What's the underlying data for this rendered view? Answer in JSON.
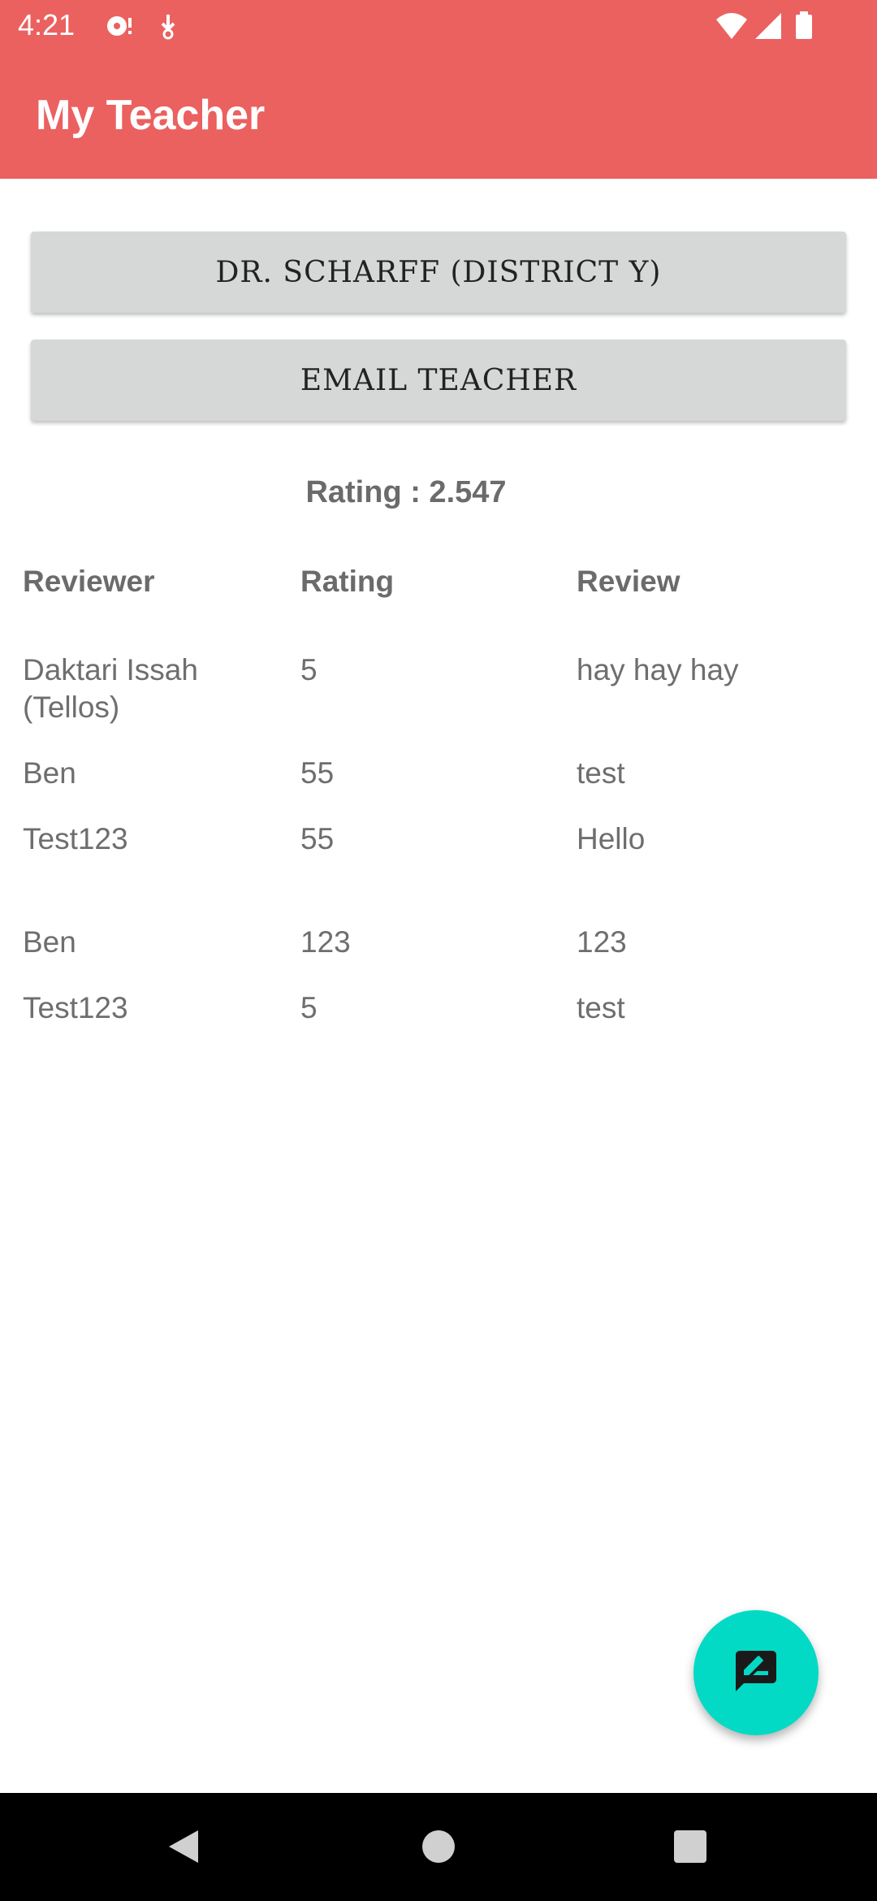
{
  "status_bar": {
    "time": "4:21",
    "left_icons": [
      "sync-icon",
      "download-icon"
    ],
    "right_icons": [
      "wifi-icon",
      "signal-icon",
      "battery-icon"
    ]
  },
  "app_bar": {
    "title": "My Teacher"
  },
  "buttons": {
    "teacher_label": "DR. SCHARFF (DISTRICT Y)",
    "email_label": "EMAIL TEACHER"
  },
  "rating_summary": "Rating : 2.547",
  "table": {
    "headers": [
      "Reviewer",
      "Rating",
      "Review"
    ],
    "rows": [
      {
        "reviewer": "Daktari Issah (Tellos)",
        "rating": "5",
        "review": "hay hay hay"
      },
      {
        "reviewer": "Ben",
        "rating": "55",
        "review": "test"
      },
      {
        "reviewer": "Test123",
        "rating": "55",
        "review": "Hello"
      },
      {
        "reviewer": "Ben",
        "rating": "123",
        "review": "123"
      },
      {
        "reviewer": "Test123",
        "rating": "5",
        "review": "test"
      }
    ]
  },
  "fab": {
    "icon": "rate-review-icon"
  },
  "colors": {
    "app_bar": "#EA6160",
    "button_bg": "#D6D7D7",
    "fab": "#03DAC5",
    "nav_bar": "#000000"
  },
  "nav_bar": {
    "icons": [
      "back-icon",
      "home-icon",
      "recents-icon"
    ]
  }
}
